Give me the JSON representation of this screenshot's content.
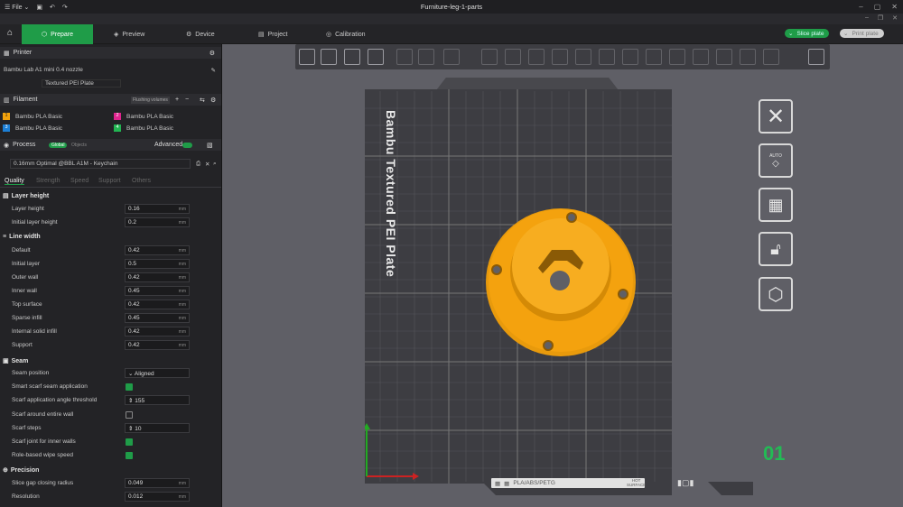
{
  "window": {
    "title": "Furniture-leg-1-parts",
    "menu_file": "File"
  },
  "tabs": [
    {
      "label": "Prepare"
    },
    {
      "label": "Preview"
    },
    {
      "label": "Device"
    },
    {
      "label": "Project"
    },
    {
      "label": "Calibration"
    }
  ],
  "actions": {
    "slice": "Slice plate",
    "print": "Print plate"
  },
  "printer": {
    "header": "Printer",
    "name": "Bambu Lab A1 mini 0.4 nozzle",
    "plate": "Textured PEI Plate"
  },
  "filament": {
    "header": "Filament",
    "flushing": "Flushing volumes",
    "slots": [
      {
        "num": "1",
        "color": "#f2a20c",
        "name": "Bambu PLA Basic"
      },
      {
        "num": "2",
        "color": "#e0248e",
        "name": "Bambu PLA Basic"
      },
      {
        "num": "3",
        "color": "#1c7fd6",
        "name": "Bambu PLA Basic"
      },
      {
        "num": "4",
        "color": "#22b552",
        "name": "Bambu PLA Basic"
      }
    ]
  },
  "process": {
    "header": "Process",
    "toggle_global": "Global",
    "toggle_objects": "Objects",
    "advanced": "Advanced",
    "preset": "0.16mm Optimal @BBL A1M - Keychain",
    "subtabs": [
      "Quality",
      "Strength",
      "Speed",
      "Support",
      "Others"
    ]
  },
  "sections": {
    "layer_height": {
      "title": "Layer height",
      "rows": [
        {
          "label": "Layer height",
          "value": "0.16",
          "unit": "mm"
        },
        {
          "label": "Initial layer height",
          "value": "0.2",
          "unit": "mm"
        }
      ]
    },
    "line_width": {
      "title": "Line width",
      "rows": [
        {
          "label": "Default",
          "value": "0.42",
          "unit": "mm"
        },
        {
          "label": "Initial layer",
          "value": "0.5",
          "unit": "mm"
        },
        {
          "label": "Outer wall",
          "value": "0.42",
          "unit": "mm"
        },
        {
          "label": "Inner wall",
          "value": "0.45",
          "unit": "mm"
        },
        {
          "label": "Top surface",
          "value": "0.42",
          "unit": "mm"
        },
        {
          "label": "Sparse infill",
          "value": "0.45",
          "unit": "mm"
        },
        {
          "label": "Internal solid infill",
          "value": "0.42",
          "unit": "mm"
        },
        {
          "label": "Support",
          "value": "0.42",
          "unit": "mm"
        }
      ]
    },
    "seam": {
      "title": "Seam",
      "position_label": "Seam position",
      "position_value": "Aligned",
      "smart_scarf": "Smart scarf seam application",
      "scarf_threshold_label": "Scarf application angle threshold",
      "scarf_threshold_value": "155",
      "scarf_entire_wall": "Scarf around entire wall",
      "scarf_steps_label": "Scarf steps",
      "scarf_steps_value": "10",
      "scarf_inner": "Scarf joint for inner walls",
      "role_wipe": "Role-based wipe speed"
    },
    "precision": {
      "title": "Precision",
      "rows": [
        {
          "label": "Slice gap closing radius",
          "value": "0.049",
          "unit": "mm"
        },
        {
          "label": "Resolution",
          "value": "0.012",
          "unit": "mm"
        }
      ]
    }
  },
  "viewport": {
    "bed_text": "Bambu Textured PEI Plate",
    "plate_number": "01",
    "bed_label": "PLA/ABS/PETG",
    "hot_surface_1": "HOT",
    "hot_surface_2": "SURFACE",
    "auto_label": "AUTO",
    "model_color": "#f4a20e"
  }
}
